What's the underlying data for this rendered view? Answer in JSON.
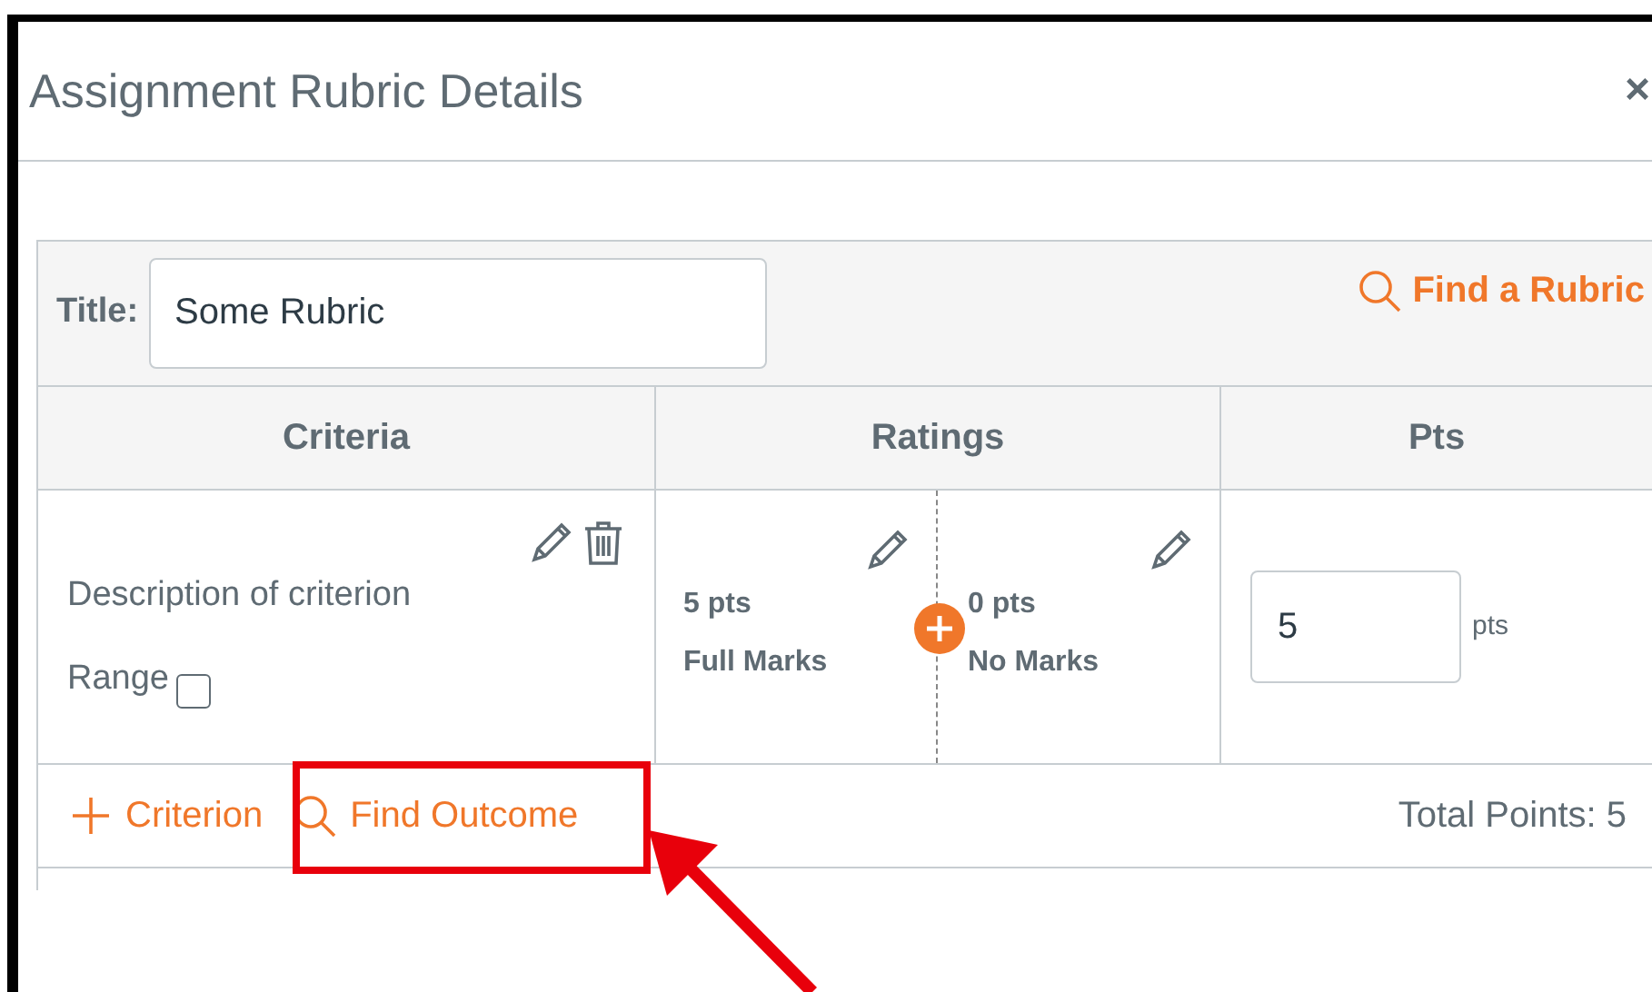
{
  "dialog": {
    "title": "Assignment Rubric Details",
    "close": "×"
  },
  "rubric": {
    "title_label": "Title:",
    "title_value": "Some Rubric",
    "find_rubric": "Find a Rubric",
    "columns": [
      "Criteria",
      "Ratings",
      "Pts"
    ],
    "criteria": [
      {
        "description": "Description of criterion",
        "range_label": "Range",
        "range_checked": false,
        "ratings": [
          {
            "points": "5 pts",
            "label": "Full Marks"
          },
          {
            "points": "0 pts",
            "label": "No Marks"
          }
        ],
        "points_value": "5",
        "points_unit": "pts"
      }
    ],
    "add_criterion": "Criterion",
    "find_outcome": "Find Outcome",
    "total": "Total Points: 5"
  },
  "annotation": {
    "find_outcome_highlighted": true
  }
}
